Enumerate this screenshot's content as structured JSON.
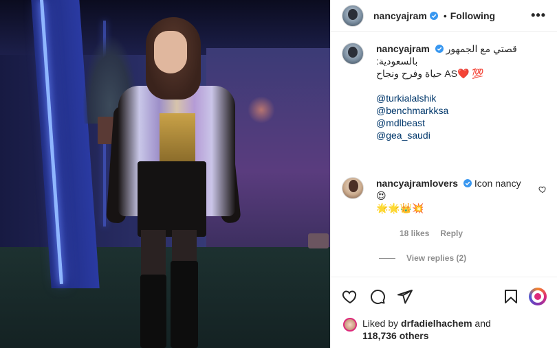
{
  "post": {
    "author": "nancyajram",
    "following_label": "Following",
    "more_label": "•••"
  },
  "caption": {
    "author": "nancyajram",
    "line1": "قصتي مع الجمهور",
    "line2": "بالسعودية:",
    "line3": "حياة وفرح ونجاح",
    "line3_tail": "AS",
    "emoji": "❤️ 💯",
    "mentions": [
      "@turkialalshik",
      "@benchmarkksa",
      "@mdlbeast",
      "@gea_saudi"
    ]
  },
  "comments": [
    {
      "author": "nancyajramlovers",
      "text": "Icon nancy😍",
      "line2": "🌟🌟👑💥",
      "likes": "18 likes",
      "reply_label": "Reply",
      "view_replies": "View replies (2)"
    }
  ],
  "likes": {
    "prefix": "Liked by",
    "user": "drfadielhachem",
    "joiner": "and",
    "count": "118,736 others"
  },
  "colors": {
    "accent_link": "#00376b",
    "verified": "#3897f0",
    "heart": "#ed4956"
  }
}
